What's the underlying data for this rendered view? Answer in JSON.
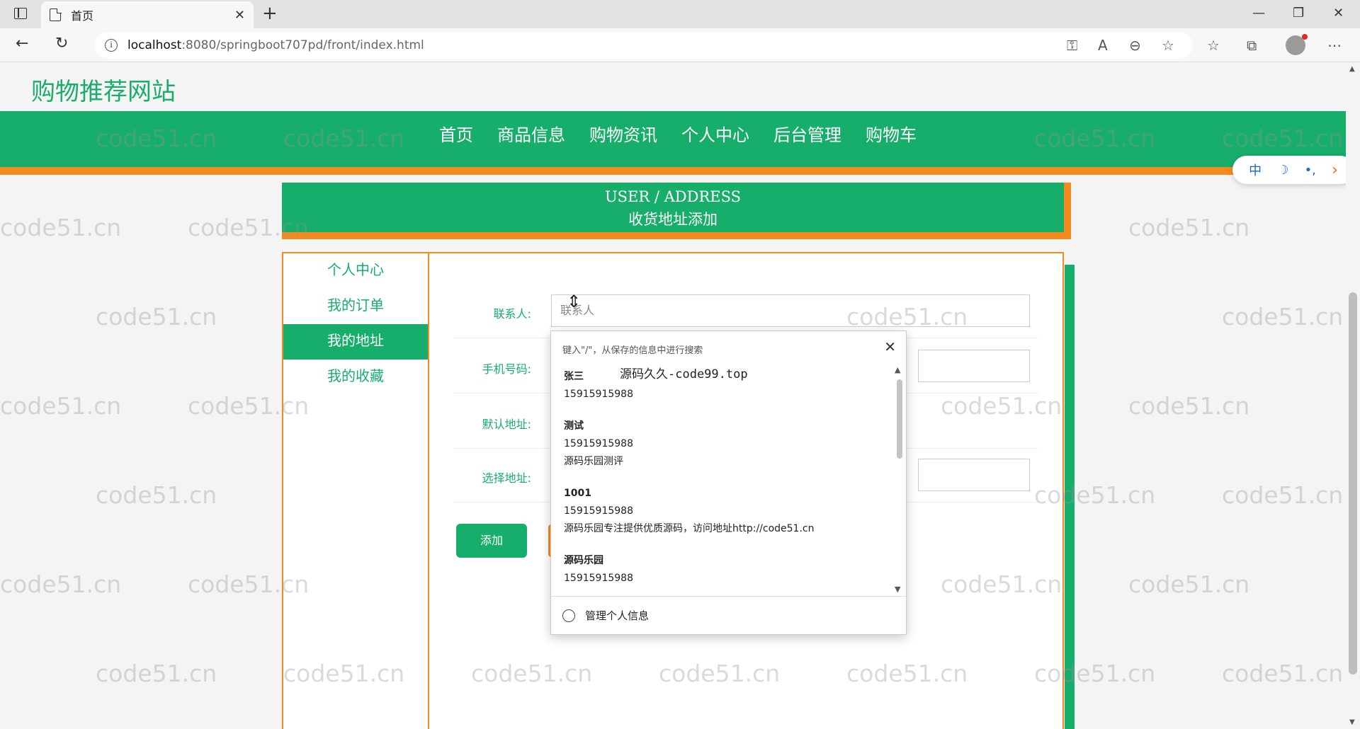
{
  "browser": {
    "tab_title": "首页",
    "url_host": "localhost",
    "url_path": ":8080/springboot707pd/front/index.html"
  },
  "site": {
    "title": "购物推荐网站",
    "nav": [
      "首页",
      "商品信息",
      "购物资讯",
      "个人中心",
      "后台管理",
      "购物车"
    ]
  },
  "floatbar": {
    "lang": "中",
    "moon": "☽",
    "dots": "•,",
    "arrow": "›"
  },
  "heading": {
    "en": "USER / ADDRESS",
    "cn": "收货地址添加"
  },
  "sidebar": {
    "items": [
      {
        "label": "个人中心",
        "active": false
      },
      {
        "label": "我的订单",
        "active": false
      },
      {
        "label": "我的地址",
        "active": true
      },
      {
        "label": "我的收藏",
        "active": false
      }
    ]
  },
  "form": {
    "contact_label": "联系人:",
    "contact_placeholder": "联系人",
    "phone_label": "手机号码:",
    "default_label": "默认地址:",
    "select_label": "选择地址:",
    "add_button": "添加"
  },
  "autofill": {
    "hint": "键入\"/\"，从保存的信息中进行搜索",
    "overlay": "源码久久-code99.top",
    "entries": [
      {
        "name": "张三",
        "lines": [
          "15915915988"
        ]
      },
      {
        "name": "测试",
        "lines": [
          "15915915988",
          "源码乐园测评"
        ]
      },
      {
        "name": "1001",
        "lines": [
          "15915915988",
          "源码乐园专注提供优质源码，访问地址http://code51.cn"
        ]
      },
      {
        "name": "源码乐园",
        "lines": [
          "15915915988"
        ]
      }
    ],
    "footer": "管理个人信息"
  },
  "watermark": "code51.cn",
  "colors": {
    "primary": "#17ad6b",
    "accent": "#f58a1f"
  }
}
